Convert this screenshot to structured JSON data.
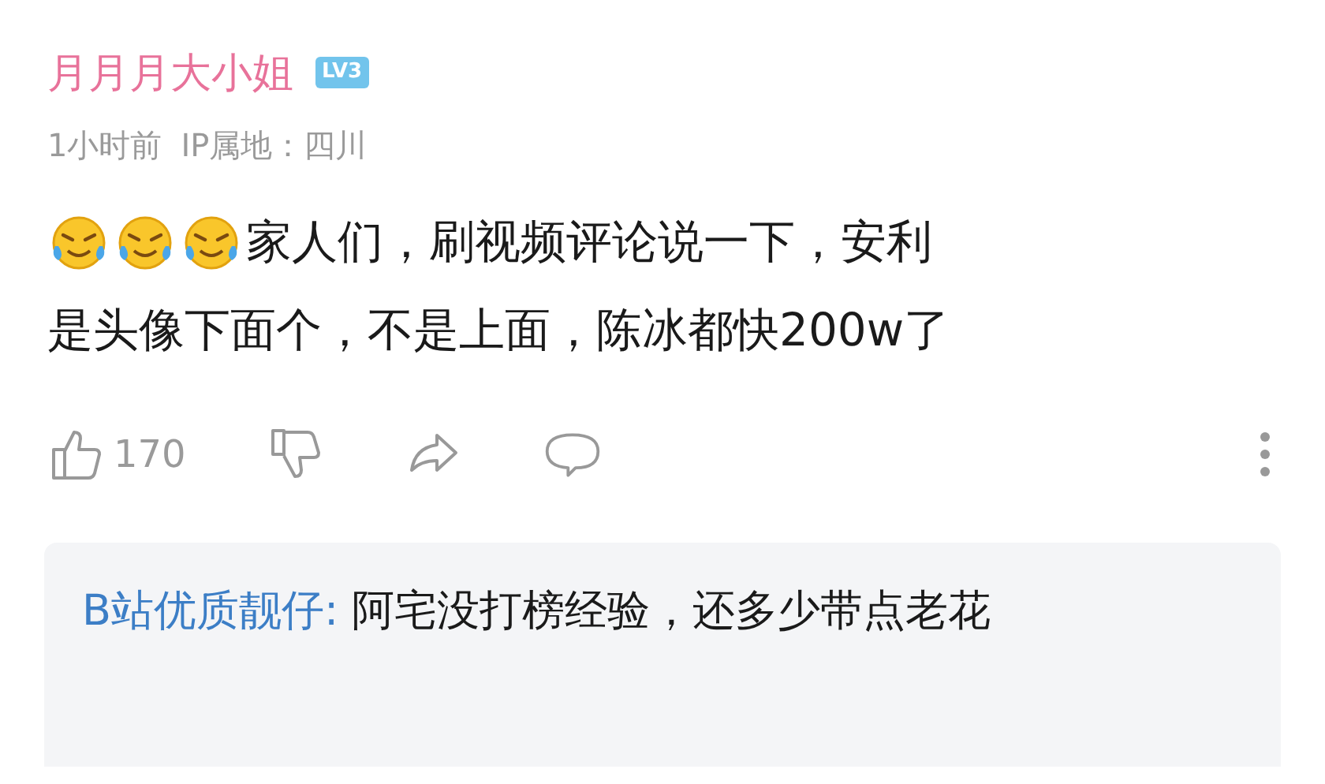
{
  "comment": {
    "author": "月月月大小姐",
    "level": "LV3",
    "time": "1小时前",
    "ip": "IP属地：四川",
    "lines": [
      "家人们，刷视频评论说一下，安利",
      "是头像下面个，不是上面，陈冰都快200w了"
    ],
    "likes": "170",
    "reply": {
      "author": "B站优质靓仔:",
      "text": " 阿宅没打榜经验，还多少带点老花"
    }
  }
}
